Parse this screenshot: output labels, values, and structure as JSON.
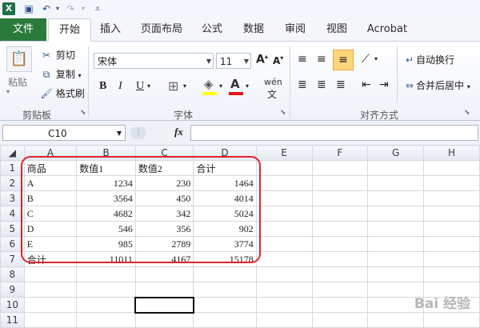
{
  "colors": {
    "file_tab": "#2a7a3c",
    "highlight": "#f5c96b",
    "annotation_red": "#e0242a"
  },
  "ribbon": {
    "tabs": [
      "文件",
      "开始",
      "插入",
      "页面布局",
      "公式",
      "数据",
      "审阅",
      "视图",
      "Acrobat"
    ],
    "clipboard": {
      "paste": "粘贴",
      "cut": "剪切",
      "copy": "复制",
      "format_painter": "格式刷",
      "group": "剪贴板"
    },
    "font": {
      "name": "宋体",
      "size": "11",
      "group": "字体"
    },
    "alignment": {
      "wrap": "自动换行",
      "merge": "合并后居中",
      "group": "对齐方式"
    }
  },
  "formula_bar": {
    "name_box": "C10",
    "fx": "fx",
    "value": ""
  },
  "sheet": {
    "columns": [
      "A",
      "B",
      "C",
      "D",
      "E",
      "F",
      "G",
      "H"
    ],
    "rows": [
      [
        "商品",
        "数值1",
        "数值2",
        "合计"
      ],
      [
        "A",
        "1234",
        "230",
        "1464"
      ],
      [
        "B",
        "3564",
        "450",
        "4014"
      ],
      [
        "C",
        "4682",
        "342",
        "5024"
      ],
      [
        "D",
        "546",
        "356",
        "902"
      ],
      [
        "E",
        "985",
        "2789",
        "3774"
      ],
      [
        "合计",
        "11011",
        "4167",
        "15178"
      ]
    ],
    "row_numbers": [
      "1",
      "2",
      "3",
      "4",
      "5",
      "6",
      "7",
      "8",
      "9",
      "10",
      "11"
    ]
  },
  "watermark": "Bai 经验"
}
